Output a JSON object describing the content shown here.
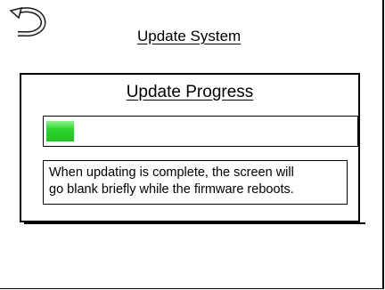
{
  "header": {
    "title": "Update System",
    "back_icon": "back-arrow-icon"
  },
  "dialog": {
    "title": "Update Progress",
    "progress_percent": 9,
    "progress_color": "#2ed62e",
    "message_lines": [
      "When updating is complete, the screen will",
      "go blank briefly while the firmware reboots."
    ]
  }
}
